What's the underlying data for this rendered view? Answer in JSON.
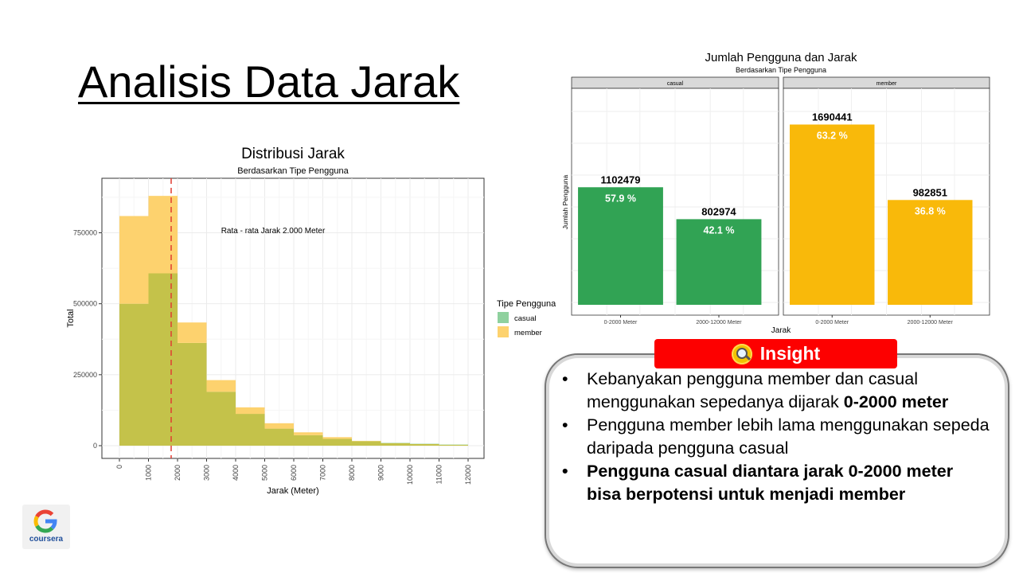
{
  "slide": {
    "title": "Analisis Data Jarak"
  },
  "chart_data": [
    {
      "type": "bar",
      "subtype": "histogram-overlay",
      "title": "Distribusi Jarak",
      "subtitle": "Berdasarkan Tipe Pengguna",
      "xlabel": "Jarak (Meter)",
      "ylabel": "Total",
      "xlim": [
        0,
        12000
      ],
      "ylim": [
        0,
        900000
      ],
      "x_ticks": [
        0,
        1000,
        2000,
        3000,
        4000,
        5000,
        6000,
        7000,
        8000,
        9000,
        10000,
        11000,
        12000
      ],
      "y_ticks": [
        0,
        250000,
        500000,
        750000
      ],
      "y_tick_labels": [
        "0",
        "250000",
        "500000",
        "750000"
      ],
      "bin_width": 1000,
      "series": [
        {
          "name": "casual",
          "color": "#8fd19e",
          "values": [
            500000,
            607000,
            362000,
            190000,
            112000,
            60000,
            37000,
            24000,
            16000,
            10000,
            7000,
            4000
          ]
        },
        {
          "name": "member",
          "color": "#fdd26e",
          "values": [
            809000,
            880000,
            434000,
            231000,
            135000,
            79000,
            47000,
            30000,
            17000,
            9000,
            6000,
            3000
          ]
        }
      ],
      "overlap_color": "#c4c24a",
      "mean_line": {
        "x": 2000,
        "color": "#e03c31"
      },
      "annotation": "Rata - rata Jarak 2.000 Meter",
      "legend": {
        "title": "Tipe Pengguna",
        "position": "right"
      },
      "grid": true
    },
    {
      "type": "bar",
      "subtype": "faceted",
      "title": "Jumlah Pengguna dan Jarak",
      "subtitle": "Berdasarkan Tipe Pengguna",
      "xlabel": "Jarak",
      "ylabel": "Jumlah Pengguna",
      "categories": [
        "0-2000 Meter",
        "2000-12000 Meter"
      ],
      "ylim": [
        0,
        2700000
      ],
      "grid": true,
      "facets": [
        {
          "name": "casual",
          "color": "#31a354",
          "values": [
            1102479,
            802974
          ],
          "labels": [
            "1102479",
            "802974"
          ],
          "percents": [
            "57.9 %",
            "42.1 %"
          ]
        },
        {
          "name": "member",
          "color": "#f9b90a",
          "values": [
            1690441,
            982851
          ],
          "labels": [
            "1690441",
            "982851"
          ],
          "percents": [
            "63.2 %",
            "36.8 %"
          ]
        }
      ]
    }
  ],
  "insight": {
    "label": "Insight",
    "icon": "magnifier-icon",
    "items": [
      {
        "text": "Kebanyakan pengguna member dan casual menggunakan sepedanya dijarak ",
        "bold": "0-2000 meter"
      },
      {
        "text": "Pengguna member lebih lama menggunakan sepeda daripada pengguna casual"
      },
      {
        "bold_full": "Pengguna casual diantara jarak 0-2000 meter bisa berpotensi untuk menjadi member"
      }
    ]
  },
  "logo": {
    "name": "coursera"
  }
}
